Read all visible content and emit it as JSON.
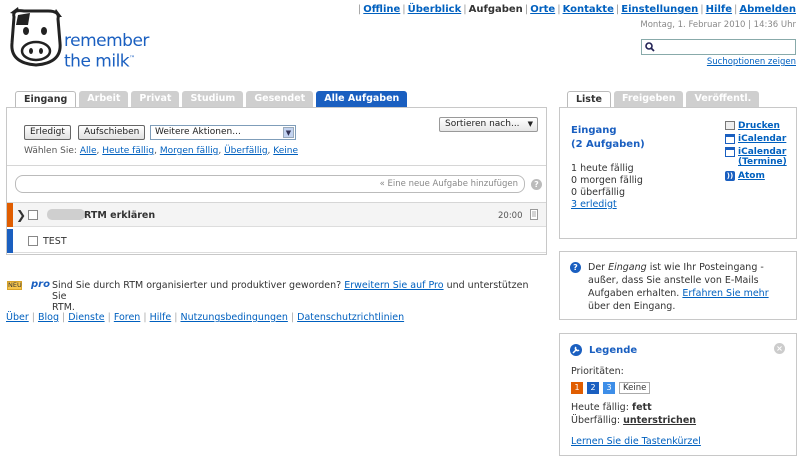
{
  "app": {
    "logo_line1": "remember",
    "logo_line2": "the milk",
    "logo_tm": "™"
  },
  "topnav": {
    "offline": "Offline",
    "overview": "Überblick",
    "tasks": "Aufgaben",
    "places": "Orte",
    "contacts": "Kontakte",
    "settings": "Einstellungen",
    "help": "Hilfe",
    "logout": "Abmelden"
  },
  "date": "Montag, 1. Februar 2010 | 14:36 Uhr",
  "search": {
    "value": "",
    "options_link": "Suchoptionen zeigen"
  },
  "tabs": [
    "Eingang",
    "Arbeit",
    "Privat",
    "Studium",
    "Gesendet",
    "Alle Aufgaben"
  ],
  "toolbar": {
    "done": "Erledigt",
    "postpone": "Aufschieben",
    "more_actions": "Weitere Aktionen...",
    "sort": "Sortieren nach..."
  },
  "select_row": {
    "label": "Wählen Sie:",
    "all": "Alle",
    "today": "Heute fällig",
    "tomorrow": "Morgen fällig",
    "overdue": "Überfällig",
    "none": "Keine"
  },
  "add_task": {
    "placeholder": "« Eine neue Aufgabe hinzufügen"
  },
  "tasks": [
    {
      "name": "RTM erklären",
      "due": "20:00",
      "priority_color": "#e05d00"
    },
    {
      "name": "TEST",
      "due": "",
      "priority_color": "#1a5fc0"
    }
  ],
  "promo": {
    "badge": "NEU",
    "pro": "pro",
    "text1": "Sind Sie durch RTM organisierter und produktiver geworden?",
    "link": "Erweitern Sie auf Pro",
    "text2": "und unterstützen Sie",
    "text3": "RTM."
  },
  "footer": [
    "Über",
    "Blog",
    "Dienste",
    "Foren",
    "Hilfe",
    "Nutzungsbedingungen",
    "Datenschutzrichtlinien"
  ],
  "right_tabs": [
    "Liste",
    "Freigeben",
    "Veröffentl."
  ],
  "list_panel": {
    "title": "Eingang",
    "count": "(2 Aufgaben)",
    "stat1": "1 heute fällig",
    "stat2": "0 morgen fällig",
    "stat3": "0 überfällig",
    "done_link": "3 erledigt",
    "print": "Drucken",
    "ical": "iCalendar",
    "ical_events_1": "iCalendar",
    "ical_events_2": "(Termine)",
    "atom": "Atom"
  },
  "info": {
    "t1": "Der",
    "em": "Eingang",
    "t2": "ist wie Ihr Posteingang -",
    "t3": "außer, dass Sie anstelle von E-Mails Aufgaben",
    "t4": "erhalten.",
    "link": "Erfahren Sie mehr",
    "t5": "über den",
    "t6": "Eingang."
  },
  "legend": {
    "title": "Legende",
    "priorities_label": "Prioritäten:",
    "p1": "1",
    "p2": "2",
    "p3": "3",
    "none": "Keine",
    "today_label": "Heute fällig:",
    "today_val": "fett",
    "overdue_label": "Überfällig:",
    "overdue_val": "unterstrichen",
    "shortcuts_link": "Lernen Sie die Tastenkürzel"
  },
  "colors": {
    "priority1": "#e05d00",
    "priority2": "#1a5fc0",
    "priority3": "#3d8ee8",
    "link": "#0060bf",
    "accent_tab": "#1a5fc0"
  }
}
